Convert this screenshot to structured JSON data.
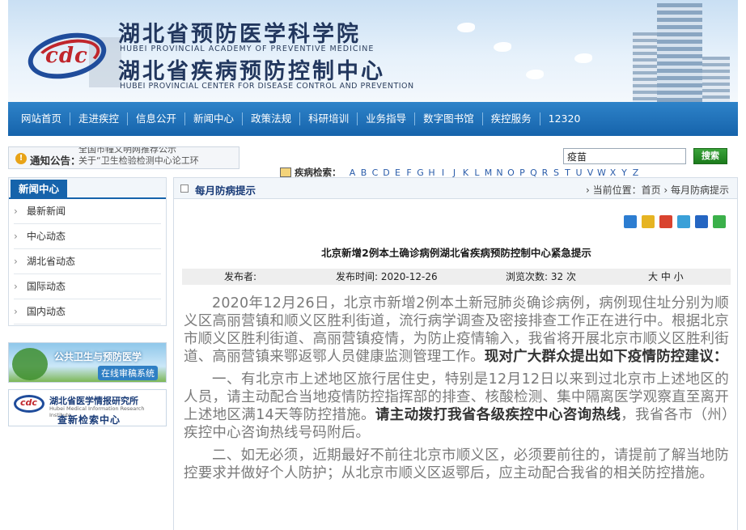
{
  "header": {
    "title_1": "湖北省预防医学科学院",
    "title_1_en": "HUBEI PROVINCIAL ACADEMY OF PREVENTIVE MEDICINE",
    "title_2": "湖北省疾病预防控制中心",
    "title_2_en": "HUBEI PROVINCIAL CENTER FOR DISEASE CONTROL AND PREVENTION",
    "logo_text": "cdc"
  },
  "nav": [
    "网站首页",
    "走进疾控",
    "信息公开",
    "新闻中心",
    "政策法规",
    "科研培训",
    "业务指导",
    "数字图书馆",
    "疾控服务",
    "12320"
  ],
  "notice": {
    "label": "通知公告：",
    "items": [
      "全国市幢义明网推荐公示",
      "关于“卫生检验检测中心论工环"
    ]
  },
  "search": {
    "value": "疫苗",
    "button": "搜索"
  },
  "disease_search": {
    "label": "疾病检索：",
    "letters": [
      "A",
      "B",
      "C",
      "D",
      "E",
      "F",
      "G",
      "H",
      "I",
      "J",
      "K",
      "L",
      "M",
      "N",
      "O",
      "P",
      "Q",
      "R",
      "S",
      "T",
      "U",
      "V",
      "W",
      "X",
      "Y",
      "Z"
    ]
  },
  "sidebar": {
    "title": "新闻中心",
    "items": [
      "最新新闻",
      "中心动态",
      "湖北省动态",
      "国际动态",
      "国内动态"
    ],
    "banner1": {
      "line1": "公共卫生与预防医学",
      "line2": "在线审稿系统"
    },
    "banner2": {
      "line1": "湖北省医学情报研究所",
      "line2": "Hubei Medical Information Research Institute",
      "line3": "查新检索中心"
    }
  },
  "main": {
    "section_title": "每月防病提示",
    "breadcrumb": "› 当前位置：首页 › 每月防病提示",
    "article_title": "北京新增2例本土确诊病例湖北省疾病预防控制中心紧急提示",
    "meta": {
      "publisher": "发布者:",
      "time": "发布时间: 2020-12-26",
      "views": "浏览次数: 32 次",
      "font_size": "大 中 小"
    },
    "paragraphs": [
      {
        "normal": "2020年12月26日，北京市新增2例本土新冠肺炎确诊病例，病例现住址分别为顺义区高丽营镇和顺义区胜利街道，流行病学调查及密接排查工作正在进行中。根据北京市顺义区胜利街道、高丽营镇疫情，为防止疫情输入，我省将开展北京市顺义区胜利街道、高丽营镇来鄂返鄂人员健康监测管理工作。",
        "bold": "现对广大群众提出如下疫情防控建议："
      },
      {
        "normal": "一、有北京市上述地区旅行居住史，特别是12月12日以来到过北京市上述地区的人员，请主动配合当地疫情防控指挥部的排查、核酸检测、集中隔离医学观察直至离开上述地区满14天等防控措施。",
        "bold": "请主动拨打我省各级疾控中心咨询热线",
        "tail": "，我省各市（州）疾控中心咨询热线号码附后。"
      },
      {
        "normal": "二、如无必须，近期最好不前往北京市顺义区，必须要前往的，请提前了解当地防控要求并做好个人防护；从北京市顺义区返鄂后，应主动配合我省的相关防控措施。"
      }
    ]
  },
  "colors": {
    "nav_blue": "#1663ab",
    "title_navy": "#22375e",
    "search_green": "#1c7b1c"
  }
}
